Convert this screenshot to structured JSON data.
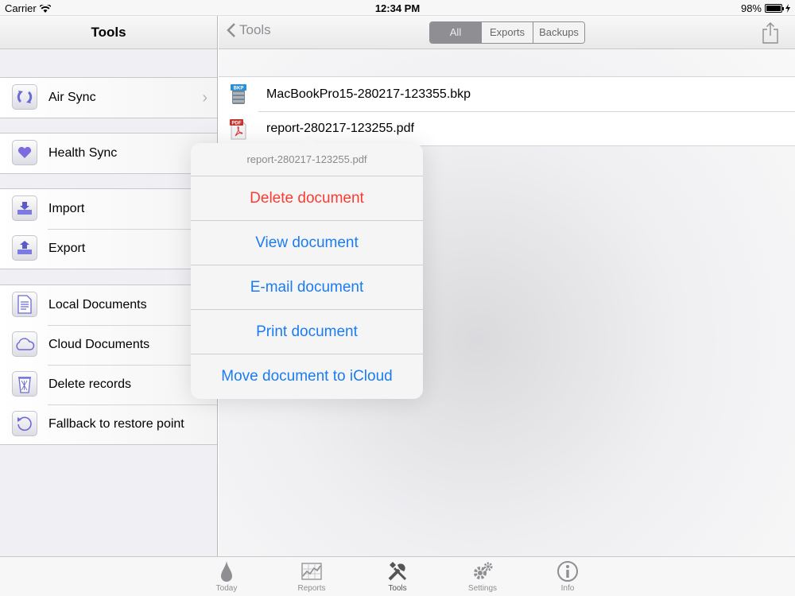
{
  "status_bar": {
    "carrier": "Carrier",
    "time": "12:34 PM",
    "battery": "98%"
  },
  "sidebar": {
    "title": "Tools",
    "groups": [
      {
        "items": [
          {
            "label": "Air Sync",
            "icon": "sync-icon",
            "disclosure": true
          }
        ]
      },
      {
        "items": [
          {
            "label": "Health Sync",
            "icon": "heart-icon"
          }
        ]
      },
      {
        "items": [
          {
            "label": "Import",
            "icon": "import-icon"
          },
          {
            "label": "Export",
            "icon": "export-icon"
          }
        ]
      },
      {
        "items": [
          {
            "label": "Local Documents",
            "icon": "document-icon"
          },
          {
            "label": "Cloud Documents",
            "icon": "cloud-icon"
          },
          {
            "label": "Delete records",
            "icon": "trash-icon"
          },
          {
            "label": "Fallback to restore point",
            "icon": "restore-icon"
          }
        ]
      }
    ]
  },
  "detail": {
    "back_label": "Tools",
    "segments": [
      "All",
      "Exports",
      "Backups"
    ],
    "selected_segment": "All",
    "files": [
      {
        "name": "MacBookPro15-280217-123355.bkp",
        "type": "BKP"
      },
      {
        "name": "report-280217-123255.pdf",
        "type": "PDF"
      }
    ]
  },
  "popover": {
    "title": "report-280217-123255.pdf",
    "actions": [
      {
        "label": "Delete document",
        "destructive": true
      },
      {
        "label": "View document"
      },
      {
        "label": "E-mail document"
      },
      {
        "label": "Print document"
      },
      {
        "label": "Move document to iCloud"
      }
    ]
  },
  "tab_bar": {
    "tabs": [
      {
        "label": "Today",
        "icon": "drop-icon"
      },
      {
        "label": "Reports",
        "icon": "chart-icon"
      },
      {
        "label": "Tools",
        "icon": "tools-icon",
        "active": true
      },
      {
        "label": "Settings",
        "icon": "gears-icon"
      },
      {
        "label": "Info",
        "icon": "info-icon"
      }
    ]
  },
  "colors": {
    "accent": "#1a7cf5",
    "destructive": "#fb3b31",
    "icon_tint": "#6b6bd6"
  }
}
